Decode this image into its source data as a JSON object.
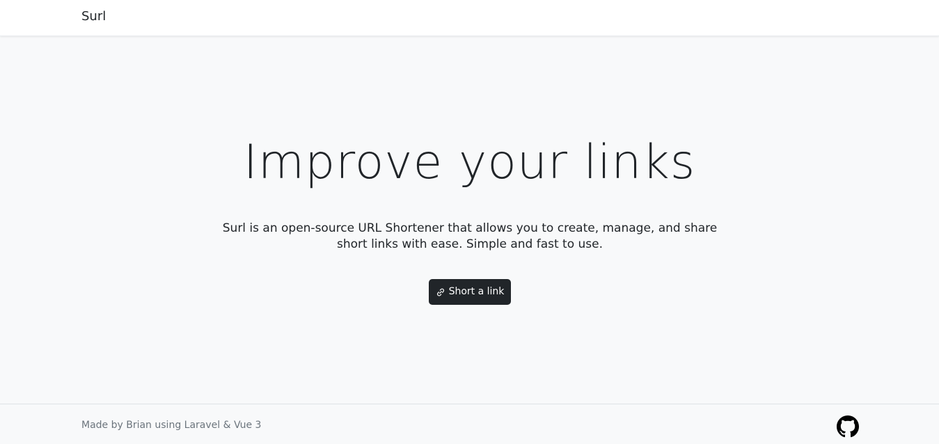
{
  "navbar": {
    "brand": "Surl"
  },
  "hero": {
    "title": "Improve your links",
    "description": "Surl is an open-source URL Shortener that allows you to create, manage, and share short links with ease. Simple and fast to use.",
    "cta_label": "Short a link",
    "cta_icon": "link-icon"
  },
  "footer": {
    "credit": "Made by Brian using Laravel & Vue 3",
    "github_icon": "github-icon"
  },
  "colors": {
    "background": "#f8f9fa",
    "navbar": "#ffffff",
    "button": "#212529",
    "text": "#212529",
    "muted": "#6c757d"
  }
}
